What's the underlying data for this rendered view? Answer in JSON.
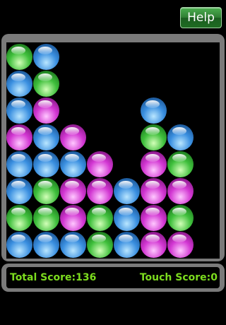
{
  "header": {
    "help_label": "Help"
  },
  "colors": {
    "blue": "#3a8fe0",
    "green": "#3fbf3c",
    "magenta": "#d236d2",
    "score_text": "#7cdc1e"
  },
  "board": {
    "rows": 8,
    "cols": 8,
    "columns_top_to_bottom": [
      [
        "green",
        "blue",
        "blue",
        "magenta",
        "blue",
        "blue",
        "green",
        "blue"
      ],
      [
        "blue",
        "green",
        "magenta",
        "blue",
        "blue",
        "green",
        "green",
        "blue"
      ],
      [
        "magenta",
        "blue",
        "magenta",
        "magenta",
        "blue"
      ],
      [
        "magenta",
        "magenta",
        "green",
        "green"
      ],
      [
        "blue",
        "blue",
        "blue"
      ],
      [
        "blue",
        "green",
        "magenta",
        "magenta",
        "magenta",
        "magenta"
      ],
      [
        "blue",
        "green",
        "magenta",
        "green",
        "magenta"
      ]
    ]
  },
  "score": {
    "total_label": "Total Score:136",
    "touch_label": "Touch Score:0"
  }
}
